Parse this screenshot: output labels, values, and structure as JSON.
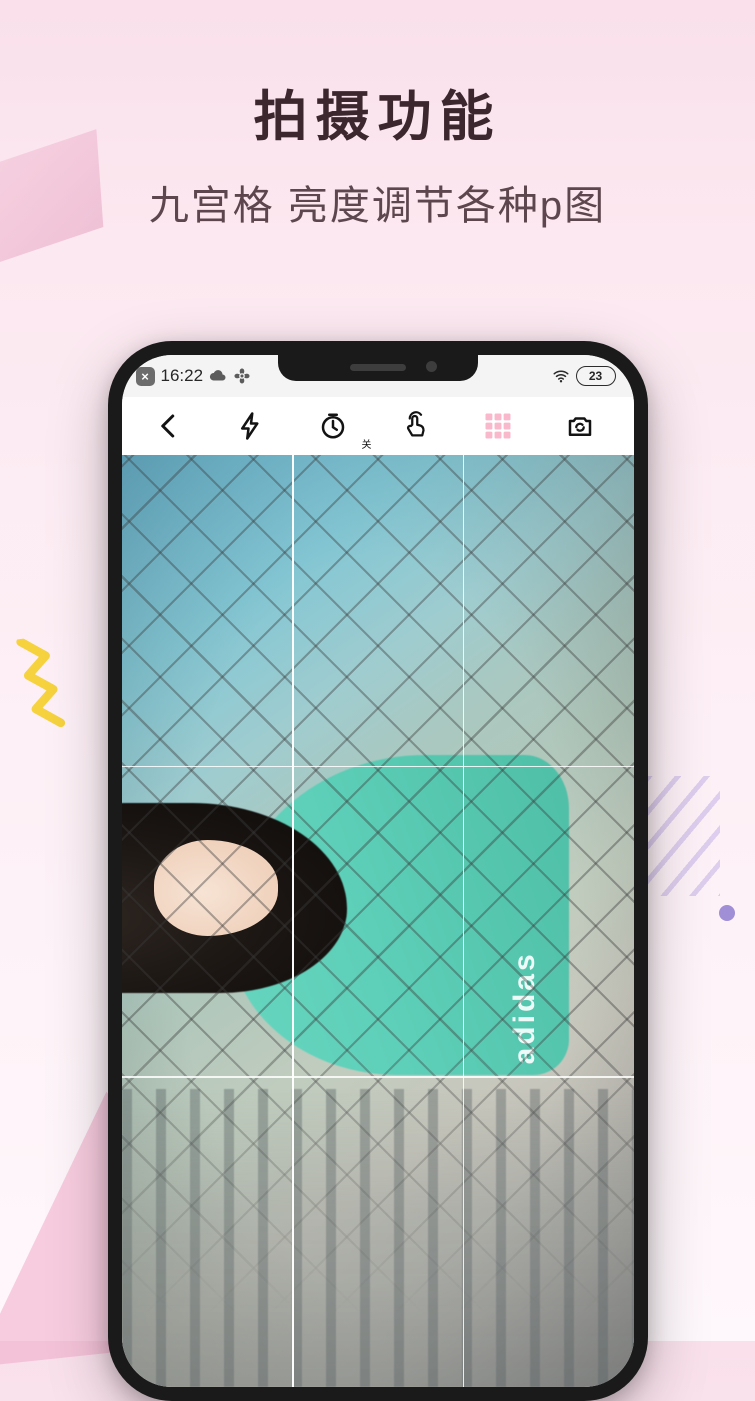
{
  "promo": {
    "title": "拍摄功能",
    "subtitle": "九宫格 亮度调节各种p图"
  },
  "status_bar": {
    "dismiss_icon": "x",
    "time": "16:22",
    "weather_icon": "cloud",
    "sync_icon": "fan",
    "wifi_icon": "wifi",
    "battery_text": "23"
  },
  "toolbar": {
    "back": "back-chevron",
    "flash": "flash",
    "timer": {
      "icon": "timer",
      "tag": "关"
    },
    "touch": "touch-shutter",
    "grid": "grid-3x3",
    "switch_cam": "switch-camera"
  },
  "viewfinder": {
    "shirt_brand": "adidas"
  }
}
